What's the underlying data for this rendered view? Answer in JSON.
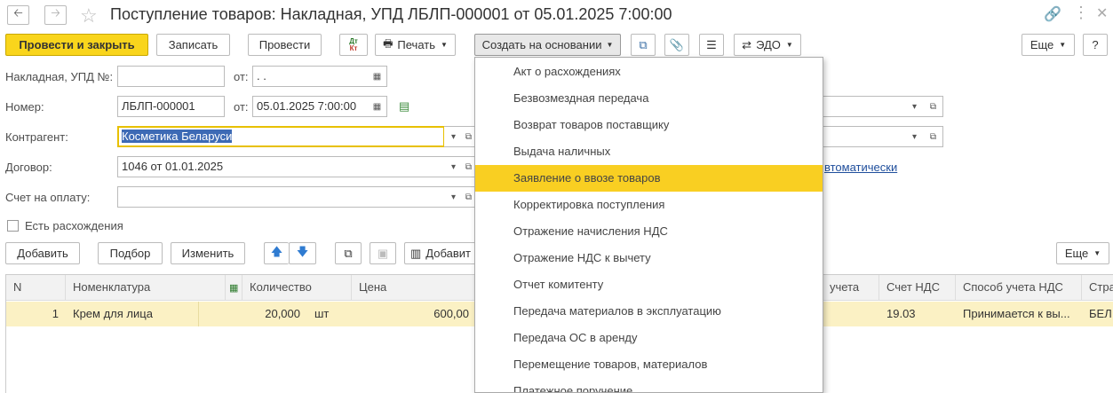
{
  "window": {
    "title": "Поступление товаров: Накладная, УПД ЛБЛП-000001 от 05.01.2025 7:00:00"
  },
  "toolbar": {
    "post_close": "Провести и закрыть",
    "save": "Записать",
    "post": "Провести",
    "dtkt_top": "Дт",
    "dtkt_bottom": "Кт",
    "print": "Печать",
    "create_based": "Создать на основании",
    "edo": "ЭДО",
    "more": "Еще",
    "help": "?"
  },
  "form": {
    "invoice_label": "Накладная, УПД №:",
    "invoice_value": "",
    "from_label1": "от:",
    "invoice_date": " .  .",
    "number_label": "Номер:",
    "number_value": "ЛБЛП-000001",
    "from_label2": "от:",
    "number_date": "05.01.2025  7:00:00",
    "counterparty_label": "Контрагент:",
    "counterparty_value": "Косметика Беларуси",
    "contract_label": "Договор:",
    "contract_value": "1046 от 01.01.2025",
    "payment_label": "Счет на оплату:",
    "payment_value": "",
    "discrepancy_label": "Есть расхождения",
    "auto_link": "втоматически"
  },
  "table_toolbar": {
    "add": "Добавить",
    "pick": "Подбор",
    "edit": "Изменить",
    "add2": "Добавит",
    "more": "Еще"
  },
  "table": {
    "headers": {
      "n": "N",
      "item": "Номенклатура",
      "qty": "Количество",
      "price": "Цена",
      "account": "учета",
      "vat_account": "Счет НДС",
      "vat_method": "Способ учета НДС",
      "country": "Стра"
    },
    "rows": [
      {
        "n": "1",
        "item": "Крем для лица",
        "qty": "20,000",
        "unit": "шт",
        "price": "600,00",
        "vat_account": "19.03",
        "vat_method": "Принимается к вы...",
        "country": "БЕЛ"
      }
    ]
  },
  "menu": {
    "items": [
      "Акт о расхождениях",
      "Безвозмездная передача",
      "Возврат товаров поставщику",
      "Выдача наличных",
      "Заявление о ввозе товаров",
      "Корректировка поступления",
      "Отражение начисления НДС",
      "Отражение НДС к вычету",
      "Отчет комитенту",
      "Передача материалов в эксплуатацию",
      "Передача ОС в аренду",
      "Перемещение товаров, материалов",
      "Платежное поручение"
    ],
    "selected_index": 4
  },
  "colors": {
    "accent": "#f9d51c",
    "selected_row": "#fbf1c4",
    "link": "#1f4e9c"
  }
}
